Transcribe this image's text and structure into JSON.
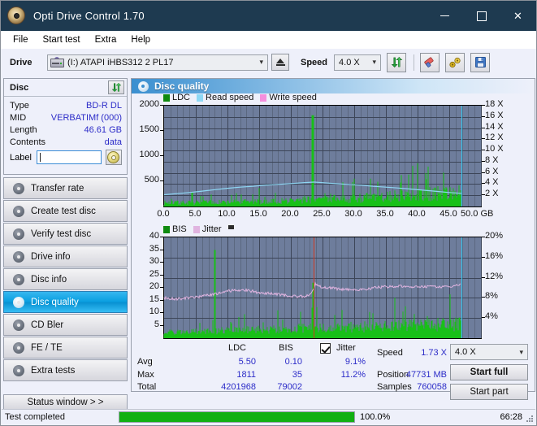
{
  "window": {
    "title": "Opti Drive Control 1.70",
    "icon": "disc-icon",
    "minimize": "─",
    "maximize": "□",
    "close": "✕"
  },
  "menu": [
    "File",
    "Start test",
    "Extra",
    "Help"
  ],
  "toolbar": {
    "drive_label": "Drive",
    "drive_value": "(I:)   ATAPI iHBS312  2 PL17",
    "eject": "eject-button",
    "speed_label": "Speed",
    "speed_value": "4.0 X",
    "refresh": "refresh-icon",
    "erase": "eraser-icon",
    "tools": "tools-icon",
    "save": "save-icon"
  },
  "disc_panel": {
    "title": "Disc",
    "refresh_icon": "refresh-icon",
    "rows": [
      {
        "key": "Type",
        "value": "BD-R DL"
      },
      {
        "key": "MID",
        "value": "VERBATIMf (000)"
      },
      {
        "key": "Length",
        "value": "46.61 GB"
      },
      {
        "key": "Contents",
        "value": "data"
      }
    ],
    "label_key": "Label",
    "label_value": "",
    "label_button": "disc-label-icon"
  },
  "nav": {
    "items": [
      {
        "label": "Transfer rate",
        "active": false
      },
      {
        "label": "Create test disc",
        "active": false
      },
      {
        "label": "Verify test disc",
        "active": false
      },
      {
        "label": "Drive info",
        "active": false
      },
      {
        "label": "Disc info",
        "active": false
      },
      {
        "label": "Disc quality",
        "active": true
      },
      {
        "label": "CD Bler",
        "active": false
      },
      {
        "label": "FE / TE",
        "active": false
      },
      {
        "label": "Extra tests",
        "active": false
      }
    ],
    "status_window": "Status window > >"
  },
  "content": {
    "header_title": "Disc quality",
    "header_icon": "disc-icon"
  },
  "stats": {
    "col_ldc": "LDC",
    "col_bis": "BIS",
    "jitter_label": "Jitter",
    "jitter_checked": true,
    "row_avg": "Avg",
    "row_max": "Max",
    "row_total": "Total",
    "avg_ldc": "5.50",
    "avg_bis": "0.10",
    "avg_jitter": "9.1%",
    "max_ldc": "1811",
    "max_bis": "35",
    "max_jitter": "11.2%",
    "total_ldc": "4201968",
    "total_bis": "79002",
    "speed_label": "Speed",
    "speed_value": "1.73 X",
    "position_label": "Position",
    "position_value": "47731 MB",
    "samples_label": "Samples",
    "samples_value": "760058",
    "speed_select": "4.0 X",
    "start_full": "Start full",
    "start_part": "Start part"
  },
  "statusbar": {
    "message": "Test completed",
    "percent": "100.0%",
    "progress": 100,
    "time": "66:28"
  },
  "chart_data": [
    {
      "id": "top",
      "type": "line",
      "title": "Disc quality - LDC / speed",
      "xlabel": "GB",
      "ylabel": "LDC",
      "xlim": [
        0,
        50
      ],
      "ylim": [
        0,
        2000
      ],
      "y2lim": [
        0,
        18
      ],
      "y2label": "X",
      "xticks": [
        0.0,
        5.0,
        10.0,
        15.0,
        20.0,
        25.0,
        30.0,
        35.0,
        40.0,
        45.0,
        50.0
      ],
      "xticklabels": [
        "0.0",
        "5.0",
        "10.0",
        "15.0",
        "20.0",
        "25.0",
        "30.0",
        "35.0",
        "40.0",
        "45.0",
        "50.0 GB"
      ],
      "yticks": [
        500,
        1000,
        1500,
        2000
      ],
      "yticklabels": [
        "500",
        "1000",
        "1500",
        "2000"
      ],
      "y2ticks": [
        2,
        4,
        6,
        8,
        10,
        12,
        14,
        16,
        18
      ],
      "y2ticklabels": [
        "2 X",
        "4 X",
        "6 X",
        "8 X",
        "10 X",
        "12 X",
        "14 X",
        "16 X",
        "18 X"
      ],
      "grid": true,
      "legend": [
        {
          "name": "LDC",
          "color": "#0f8a10"
        },
        {
          "name": "Read speed",
          "color": "#8fd8f5"
        },
        {
          "name": "Write speed",
          "color": "#f58fdd"
        }
      ],
      "markers": [
        {
          "name": "end-of-data",
          "x": 46.9,
          "color": "#36c8f0"
        }
      ],
      "series": [
        {
          "name": "Read speed",
          "color": "#8fd8f5",
          "axis": "y2",
          "x": [
            0,
            2,
            4,
            6,
            8,
            10,
            12,
            14,
            16,
            18,
            20,
            22,
            23.6,
            23.7,
            25,
            27,
            29,
            31,
            33,
            35,
            37,
            39,
            41,
            43,
            45,
            46.9
          ],
          "values": [
            2.1,
            2.3,
            2.5,
            2.75,
            3.0,
            3.25,
            3.45,
            3.6,
            3.8,
            3.95,
            4.1,
            4.25,
            4.35,
            4.35,
            4.25,
            4.1,
            3.95,
            3.8,
            3.6,
            3.45,
            3.3,
            3.1,
            2.9,
            2.7,
            2.5,
            2.35
          ]
        },
        {
          "name": "LDC",
          "color": "#18c018",
          "axis": "y1",
          "note": "per-sample error counts, spiky baseline ~40-150 with peaks",
          "peak_max": 1811,
          "peak_at": 23.45
        }
      ]
    },
    {
      "id": "bottom",
      "type": "line",
      "title": "Disc quality - BIS / jitter",
      "xlabel": "GB",
      "ylabel": "BIS",
      "xlim": [
        0,
        50
      ],
      "ylim": [
        0,
        40
      ],
      "y2lim": [
        0,
        20
      ],
      "y2label": "%",
      "xticks": [
        0.0,
        5.0,
        10.0,
        15.0,
        20.0,
        25.0,
        30.0,
        35.0,
        40.0,
        45.0,
        50.0
      ],
      "xticklabels": [
        "0.0",
        "5.0",
        "10.0",
        "15.0",
        "20.0",
        "25.0",
        "30.0",
        "35.0",
        "40.0",
        "45.0",
        "50.0 GB"
      ],
      "yticks": [
        5,
        10,
        15,
        20,
        25,
        30,
        35,
        40
      ],
      "yticklabels": [
        "5",
        "10",
        "15",
        "20",
        "25",
        "30",
        "35",
        "40"
      ],
      "y2ticks": [
        4,
        8,
        12,
        16,
        20
      ],
      "y2ticklabels": [
        "4%",
        "8%",
        "12%",
        "16%",
        "20%"
      ],
      "grid": true,
      "legend": [
        {
          "name": "BIS",
          "color": "#0f8a10"
        },
        {
          "name": "Jitter",
          "color": "#e0b4e0"
        },
        {
          "name": "",
          "color": "#2b2b2b"
        }
      ],
      "markers": [
        {
          "name": "layer-break",
          "x": 23.6,
          "color": "#d03a20"
        },
        {
          "name": "end-of-data",
          "x": 46.9,
          "color": "#36c8f0"
        }
      ],
      "series": [
        {
          "name": "Jitter",
          "color": "#e0b4e0",
          "axis": "y2",
          "x": [
            0,
            1,
            2,
            3,
            4,
            5,
            6,
            7,
            8,
            9,
            10,
            11,
            12,
            13,
            14,
            15,
            16,
            17,
            18,
            19,
            20,
            21,
            22,
            23,
            23.5,
            23.8,
            24.5,
            26,
            28,
            30,
            32,
            34,
            36,
            38,
            40,
            42,
            44,
            46,
            46.9
          ],
          "values": [
            8.0,
            7.8,
            7.8,
            7.9,
            8.0,
            8.1,
            8.3,
            8.5,
            8.8,
            9.0,
            9.3,
            9.5,
            9.6,
            9.5,
            9.3,
            9.0,
            8.9,
            8.9,
            8.7,
            8.5,
            8.4,
            8.3,
            8.3,
            8.6,
            9.4,
            10.8,
            10.2,
            10.0,
            9.7,
            9.6,
            9.8,
            10.1,
            10.3,
            10.3,
            10.2,
            10.2,
            10.1,
            10.4,
            10.7
          ]
        },
        {
          "name": "BIS",
          "color": "#18c018",
          "axis": "y1",
          "note": "per-sample burst error counts, baseline ~1-4 with peaks",
          "peak_max": 35,
          "peak_at": 8.0
        }
      ]
    }
  ]
}
